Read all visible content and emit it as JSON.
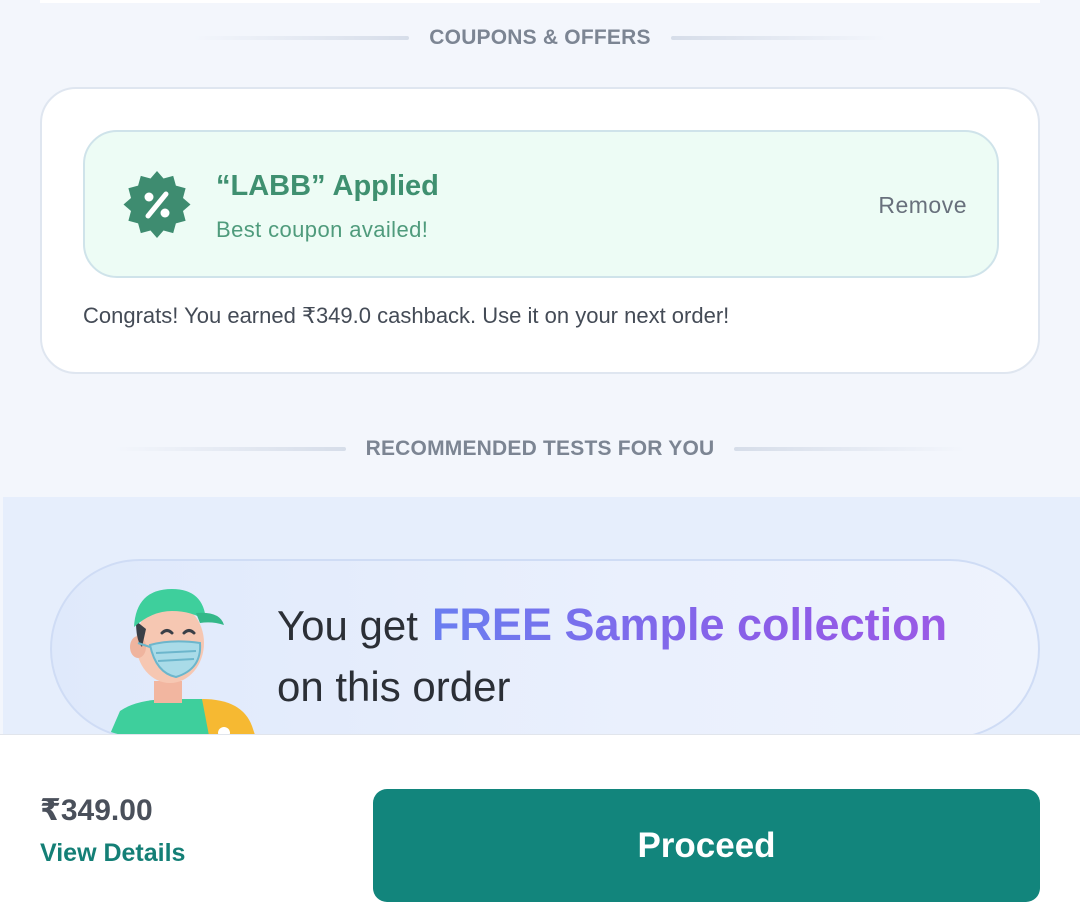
{
  "sections": {
    "coupons_title": "COUPONS & OFFERS",
    "recommended_title": "RECOMMENDED TESTS FOR YOU"
  },
  "coupon": {
    "title": "“LABB” Applied",
    "subtitle": "Best coupon availed!",
    "remove_label": "Remove",
    "cashback_message": "Congrats! You earned ₹349.0 cashback. Use it on your next order!",
    "badge_icon": "percent-badge-icon",
    "colors": {
      "badge": "#3e8c70",
      "text": "#3f9070",
      "background": "#edfcf5"
    }
  },
  "promo": {
    "line1_prefix": "You get",
    "highlight": "FREE Sample collection",
    "line2": "on this order",
    "illustration": "masked-delivery-person-illustration",
    "colors": {
      "gradient_start": "#6a7ef0",
      "gradient_end": "#9a5ae6"
    }
  },
  "footer": {
    "price": "₹349.00",
    "view_details_label": "View Details",
    "proceed_label": "Proceed",
    "colors": {
      "accent": "#12857c"
    }
  }
}
